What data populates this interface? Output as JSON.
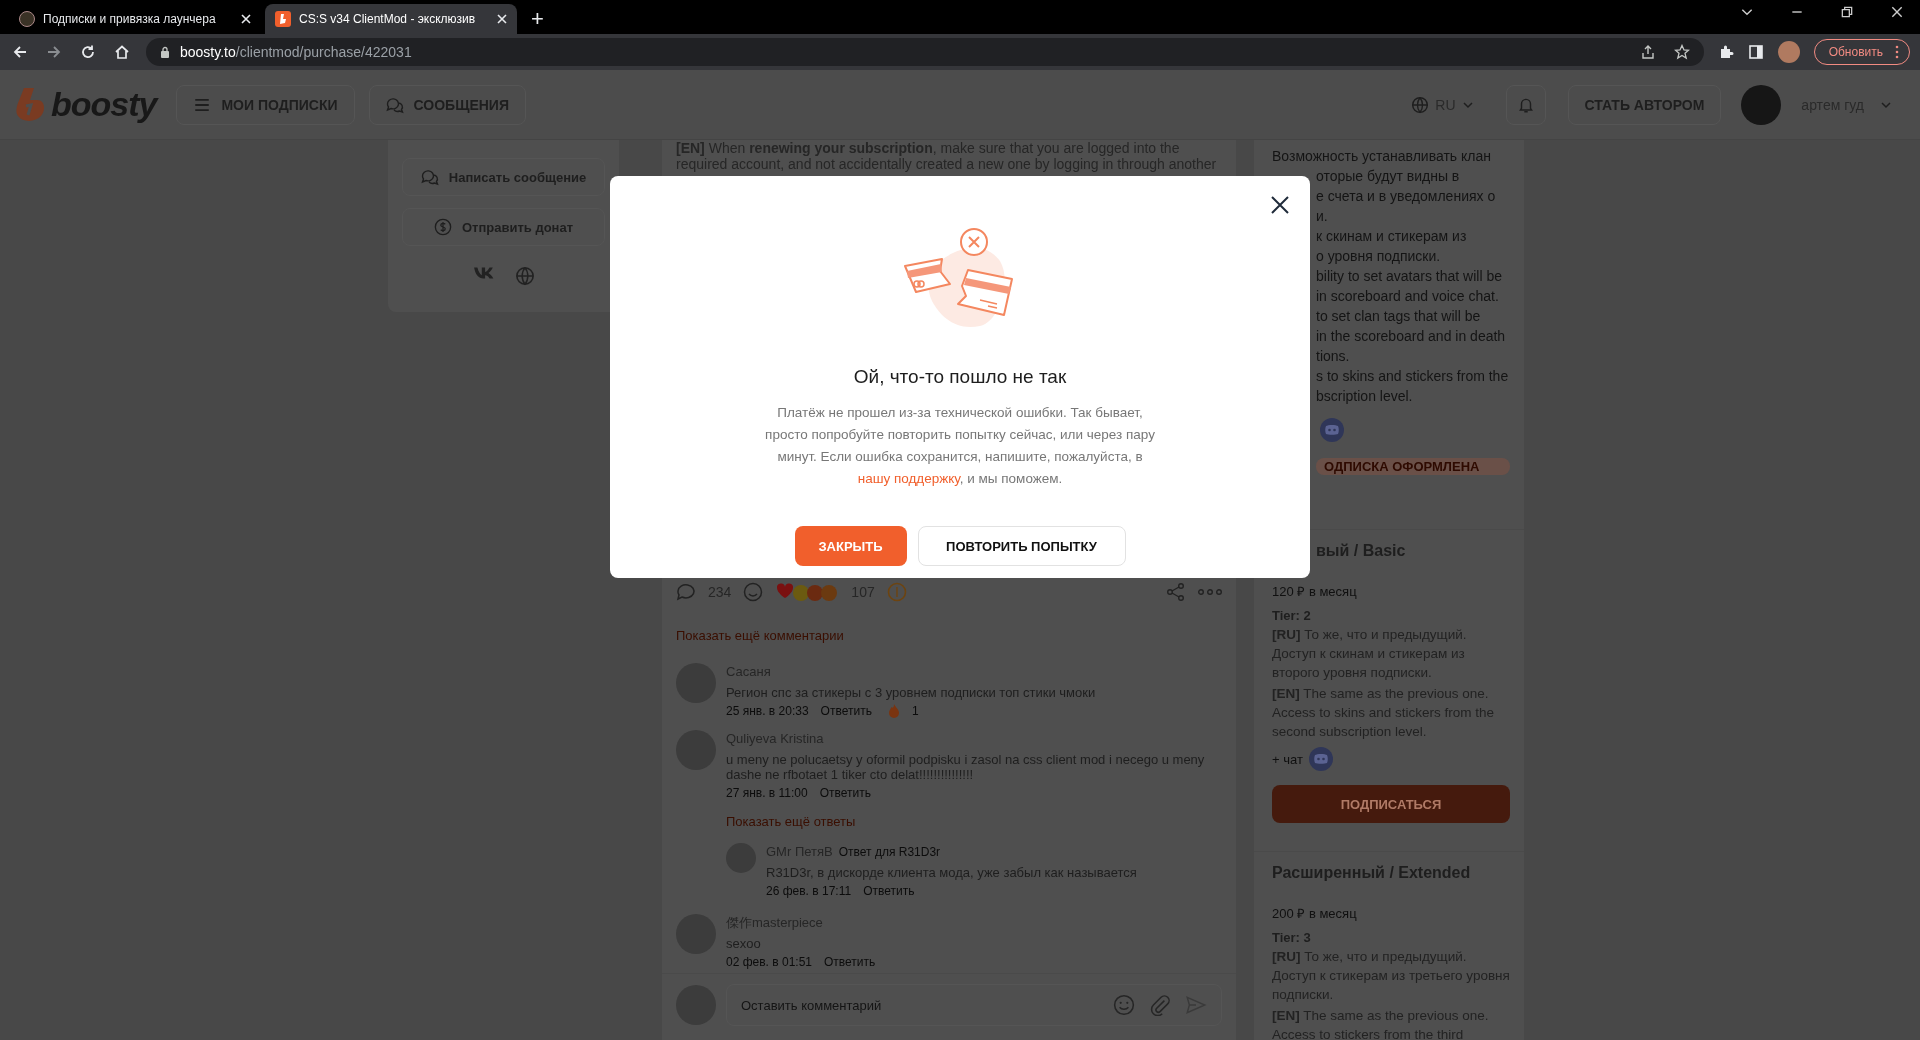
{
  "browser": {
    "tabs": [
      {
        "title": "Подписки и привязка лаунчера",
        "selected": false
      },
      {
        "title": "CS:S v34 ClientMod - эксклюзив",
        "selected": true
      }
    ],
    "new_tab": "+",
    "url_host": "boosty.to",
    "url_path": "/clientmod/purchase/422031",
    "update_button": "Обновить"
  },
  "header": {
    "logo": "boosty",
    "nav": [
      {
        "label": "МОИ ПОДПИСКИ",
        "kind": "menu"
      },
      {
        "label": "СООБЩЕНИЯ",
        "kind": "chat"
      }
    ],
    "language": "RU",
    "become_author": "СТАТЬ АВТОРОМ",
    "user_name": "артем гуд"
  },
  "sidebar": {
    "actions": [
      {
        "label": "Написать сообщение",
        "kind": "message"
      },
      {
        "label": "Отправить донат",
        "kind": "donate"
      }
    ]
  },
  "post": {
    "text_lines": [
      "**[EN]** When **renewing your subscription**, make sure that you are logged into the",
      "required account, and not accidentally created a new one by logging in through another"
    ],
    "comments_count": "234",
    "reactions_count": "107"
  },
  "comments": {
    "show_more": "Показать ещё комментарии",
    "items": [
      {
        "author": "Сасаня",
        "text": "Регион спс за стикеры с 3 уровнем подписки топ стики чмоки",
        "date": "25 янв. в 20:33",
        "reply": "Ответить",
        "reaction_count": "1"
      },
      {
        "author": "Quliyeva Kristina",
        "text": "u meny ne polucaetsy y oformil podpisku i zasol na css client mod i necego u meny dashe ne rfbotaet 1 tiker cto delat!!!!!!!!!!!!!!!",
        "date": "27 янв. в 11:00",
        "reply": "Ответить",
        "more_replies": "Показать ещё ответы",
        "replies": [
          {
            "author": "GMr ПетяВ",
            "reply_to": "Ответ для R31D3r",
            "text": "R31D3r, в дискорде клиента мода, уже забыл как называется",
            "date": "26 фев. в 17:11",
            "reply": "Ответить"
          }
        ]
      },
      {
        "author": "傑作masterpiece",
        "text": "sexoo",
        "date": "02 фев. в 01:51",
        "reply": "Ответить"
      }
    ],
    "input_placeholder": "Оставить комментарий"
  },
  "tiers_panel": {
    "top_line": "Возможность устанавливать клан",
    "cut_lines": [
      "оторые будут видны в",
      "е счета и в уведомлениях о",
      "и.",
      "к скинам и стикерам из",
      "о уровня подписки.",
      "bility to set avatars that will be",
      "in scoreboard and voice chat.",
      "to set clan tags that will be",
      "in the scoreboard and in death",
      "tions.",
      "s to skins and stickers from the",
      "bscription level."
    ],
    "subscribed_button": "ОДПИСКА ОФОРМЛЕНА",
    "tiers": [
      {
        "title": "вый / Basic",
        "title_cut": true,
        "price": "120 ₽ в месяц",
        "tier": "Tier: 2",
        "paragraphs": [
          "**[RU]** То же, что и предыдущий. Доступ к скинам и стикерам из второго уровня подписки.",
          "**[EN]** The same as the previous one. Access to skins and stickers from the second subscription level."
        ],
        "chat": "+ чат",
        "button": "ПОДПИСАТЬСЯ"
      },
      {
        "title": "Расширенный / Extended",
        "title_cut": false,
        "price": "200 ₽ в месяц",
        "tier": "Tier: 3",
        "paragraphs": [
          "**[RU]** То же, что и предыдущий. Доступ к стикерам из третьего уровня подписки.",
          "**[EN]** The same as the previous one. Access to stickers from the third"
        ]
      }
    ]
  },
  "modal": {
    "title": "Ой, что-то пошло не так",
    "message_before": "Платёж не прошел из-за технической ошибки. Так бывает, просто попробуйте повторить попытку сейчас, или через пару минут. Если ошибка сохранится, напишите, пожалуйста, в",
    "link": "нашу поддержку",
    "message_after": ", и мы поможем.",
    "buttons": [
      {
        "label": "ЗАКРЫТЬ",
        "kind": "primary"
      },
      {
        "label": "ПОВТОРИТЬ ПОПЫТКУ",
        "kind": "secondary"
      }
    ]
  }
}
